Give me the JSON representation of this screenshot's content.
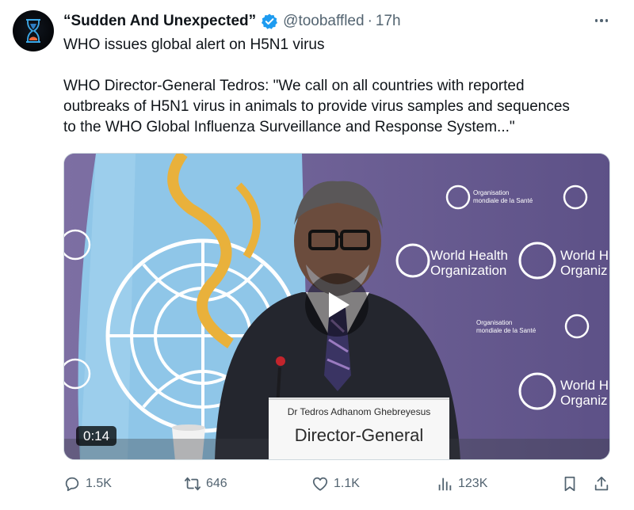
{
  "author": {
    "display_name": "“Sudden And Unexpected”",
    "handle": "@toobaffled",
    "separator": "·",
    "time": "17h",
    "avatar_icon": "hourglass-icon",
    "verified_icon": "verified-badge-icon"
  },
  "tweet": {
    "line1": "WHO issues global alert on H5N1 virus",
    "line2": "WHO Director-General Tedros: \"We call on all countries with reported",
    "line3": "outbreaks of H5N1 virus in animals to provide virus samples and sequences",
    "line4": "to the WHO Global Influenza Surveillance and Response System...\""
  },
  "media": {
    "duration": "0:14",
    "nameplate_name": "Dr Tedros Adhanom Ghebreyesus",
    "nameplate_title": "Director-General",
    "backdrop_org_name": "World Health",
    "backdrop_org_name2": "Organization",
    "backdrop_org_fr": "Organisation",
    "backdrop_org_fr2": "mondiale de la Santé",
    "backdrop_org_cut": "World H",
    "backdrop_org_cut2": "Organiz",
    "play_icon": "play-icon"
  },
  "actions": {
    "replies": "1.5K",
    "reposts": "646",
    "likes": "1.1K",
    "views": "123K"
  },
  "colors": {
    "text": "#0f1419",
    "muted": "#536471",
    "verified": "#1d9bf0",
    "backdrop": "#6a5f8f"
  }
}
